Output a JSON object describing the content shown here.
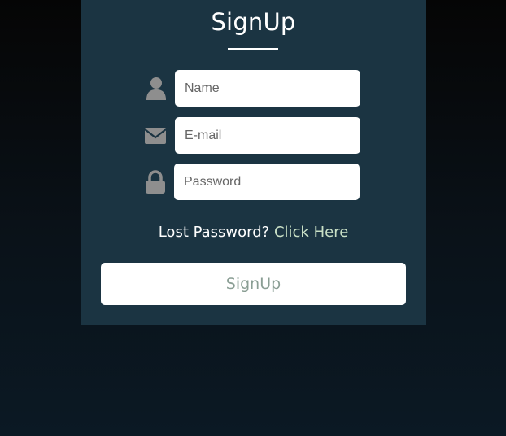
{
  "form": {
    "title": "SignUp",
    "fields": [
      {
        "icon": "user-icon",
        "placeholder": "Name",
        "value": ""
      },
      {
        "icon": "envelope-icon",
        "placeholder": "E-mail",
        "value": ""
      },
      {
        "icon": "lock-icon",
        "placeholder": "Password",
        "value": ""
      }
    ],
    "lost_password_text": "Lost Password?",
    "lost_password_link": "Click Here",
    "submit_label": "SignUp"
  },
  "colors": {
    "card_background": "#1b3442",
    "page_background": "#0a1219",
    "icon_color": "#8e8e8e",
    "link_color": "#c9e0c6",
    "button_text_color": "#8a9e94"
  }
}
